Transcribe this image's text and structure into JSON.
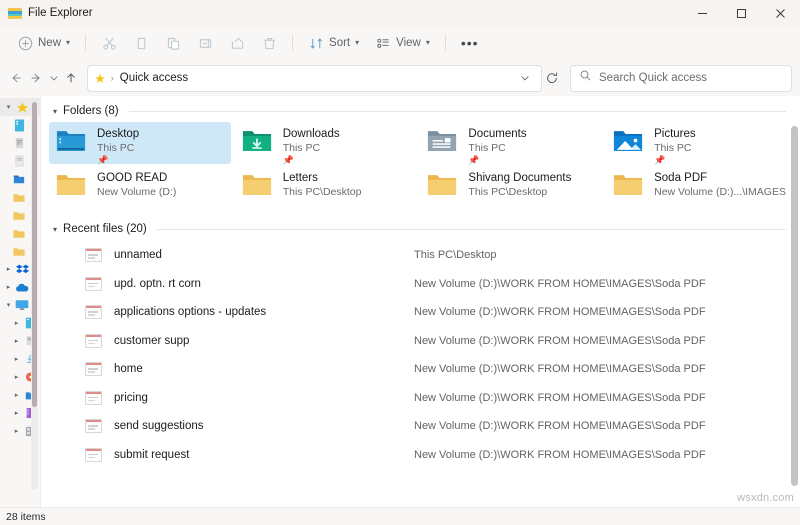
{
  "window": {
    "title": "File Explorer",
    "app_icon": "folder-icon",
    "controls": {
      "minimize": "minimize-icon",
      "maximize": "maximize-icon",
      "close": "close-icon"
    }
  },
  "toolbar": {
    "new_label": "New",
    "sort_label": "Sort",
    "view_label": "View",
    "more_label": "•••",
    "items": [
      {
        "name": "cut-button",
        "icon": "scissors-icon"
      },
      {
        "name": "copy-button",
        "icon": "copy-icon"
      },
      {
        "name": "paste-button",
        "icon": "paste-icon"
      },
      {
        "name": "rename-button",
        "icon": "rename-icon"
      },
      {
        "name": "share-button",
        "icon": "share-icon"
      },
      {
        "name": "delete-button",
        "icon": "trash-icon"
      }
    ]
  },
  "addressbar": {
    "back": "back-arrow-icon",
    "forward": "forward-arrow-icon",
    "recent": "chevron-down-icon",
    "up": "up-arrow-icon",
    "star_icon": "star-icon",
    "separator": "›",
    "breadcrumb": "Quick access",
    "dropdown": "chevron-down-icon",
    "refresh": "refresh-icon"
  },
  "search": {
    "icon": "search-icon",
    "placeholder": "Search Quick access"
  },
  "sidebar": {
    "items": [
      {
        "name": "sidebar-item-quick-access",
        "icon": "star-icon",
        "expander": "chevron-down",
        "selected": true,
        "indent": false
      },
      {
        "name": "sidebar-item-desktop",
        "icon": "desktop-icon",
        "expander": "",
        "selected": false,
        "indent": true
      },
      {
        "name": "sidebar-item-downloads",
        "icon": "downloads-icon",
        "expander": "",
        "selected": false,
        "indent": true
      },
      {
        "name": "sidebar-item-documents",
        "icon": "documents-icon",
        "expander": "",
        "selected": false,
        "indent": true
      },
      {
        "name": "sidebar-item-pictures",
        "icon": "pictures-icon",
        "expander": "",
        "selected": false,
        "indent": true
      },
      {
        "name": "sidebar-item-good-read",
        "icon": "folder-icon",
        "expander": "",
        "selected": false,
        "indent": true
      },
      {
        "name": "sidebar-item-letters",
        "icon": "folder-icon",
        "expander": "",
        "selected": false,
        "indent": true
      },
      {
        "name": "sidebar-item-shivang",
        "icon": "folder-icon",
        "expander": "",
        "selected": false,
        "indent": true
      },
      {
        "name": "sidebar-item-soda-pdf",
        "icon": "folder-icon",
        "expander": "",
        "selected": false,
        "indent": true
      },
      {
        "name": "sidebar-item-dropbox",
        "icon": "dropbox-icon",
        "expander": "chevron-right",
        "selected": false,
        "indent": false
      },
      {
        "name": "sidebar-item-onedrive",
        "icon": "cloud-icon",
        "expander": "chevron-right",
        "selected": false,
        "indent": false
      },
      {
        "name": "sidebar-item-this-pc",
        "icon": "monitor-icon",
        "expander": "chevron-down",
        "selected": false,
        "indent": false
      },
      {
        "name": "sidebar-item-pc-desktop",
        "icon": "desktop-icon",
        "expander": "chevron-right",
        "selected": false,
        "indent": true
      },
      {
        "name": "sidebar-item-pc-documents",
        "icon": "documents-icon",
        "expander": "chevron-right",
        "selected": false,
        "indent": true
      },
      {
        "name": "sidebar-item-pc-downloads",
        "icon": "downloads-icon",
        "expander": "chevron-right",
        "selected": false,
        "indent": true
      },
      {
        "name": "sidebar-item-pc-music",
        "icon": "music-icon",
        "expander": "chevron-right",
        "selected": false,
        "indent": true
      },
      {
        "name": "sidebar-item-pc-pictures",
        "icon": "pictures-icon",
        "expander": "chevron-right",
        "selected": false,
        "indent": true
      },
      {
        "name": "sidebar-item-pc-videos",
        "icon": "videos-icon",
        "expander": "chevron-right",
        "selected": false,
        "indent": true
      },
      {
        "name": "sidebar-item-local-disk",
        "icon": "drive-icon",
        "expander": "chevron-right",
        "selected": false,
        "indent": true
      }
    ]
  },
  "main": {
    "folders_group": {
      "label": "Folders (8)",
      "expanded": true
    },
    "folders": [
      {
        "name": "Desktop",
        "sub": "This PC",
        "icon": "desktop-folder-icon",
        "pinned": true,
        "selected": true
      },
      {
        "name": "Downloads",
        "sub": "This PC",
        "icon": "downloads-folder-icon",
        "pinned": true,
        "selected": false
      },
      {
        "name": "Documents",
        "sub": "This PC",
        "icon": "documents-folder-icon",
        "pinned": true,
        "selected": false
      },
      {
        "name": "Pictures",
        "sub": "This PC",
        "icon": "pictures-folder-icon",
        "pinned": true,
        "selected": false
      },
      {
        "name": "GOOD READ",
        "sub": "New Volume (D:)",
        "icon": "folder-icon",
        "pinned": false,
        "selected": false
      },
      {
        "name": "Letters",
        "sub": "This PC\\Desktop",
        "icon": "folder-icon",
        "pinned": false,
        "selected": false
      },
      {
        "name": "Shivang Documents",
        "sub": "This PC\\Desktop",
        "icon": "folder-icon",
        "pinned": false,
        "selected": false
      },
      {
        "name": "Soda PDF",
        "sub": "New Volume (D:)...\\IMAGES",
        "icon": "folder-icon",
        "pinned": false,
        "selected": false
      }
    ],
    "recent_group": {
      "label": "Recent files (20)",
      "expanded": true
    },
    "recent_files": [
      {
        "name": "unnamed",
        "path": "This PC\\Desktop"
      },
      {
        "name": "upd. optn. rt corn",
        "path": "New Volume (D:)\\WORK FROM HOME\\IMAGES\\Soda PDF"
      },
      {
        "name": "applications options - updates",
        "path": "New Volume (D:)\\WORK FROM HOME\\IMAGES\\Soda PDF"
      },
      {
        "name": "customer supp",
        "path": "New Volume (D:)\\WORK FROM HOME\\IMAGES\\Soda PDF"
      },
      {
        "name": "home",
        "path": "New Volume (D:)\\WORK FROM HOME\\IMAGES\\Soda PDF"
      },
      {
        "name": "pricing",
        "path": "New Volume (D:)\\WORK FROM HOME\\IMAGES\\Soda PDF"
      },
      {
        "name": "send suggestions",
        "path": "New Volume (D:)\\WORK FROM HOME\\IMAGES\\Soda PDF"
      },
      {
        "name": "submit request",
        "path": "New Volume (D:)\\WORK FROM HOME\\IMAGES\\Soda PDF"
      }
    ]
  },
  "statusbar": {
    "item_count": "28 items"
  },
  "watermark": "wsxdn.com",
  "colors": {
    "selection": "#cfe8f7",
    "accent_yellow": "#f5c518",
    "folder_yellow": "#f2c762",
    "desktop_blue": "#1678c2",
    "downloads_green": "#13a97f",
    "pictures_blue": "#0f7fd4"
  }
}
